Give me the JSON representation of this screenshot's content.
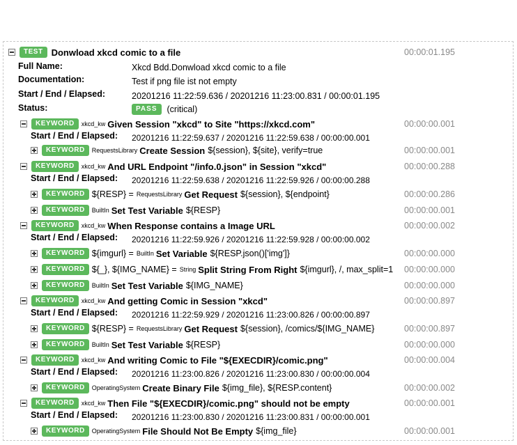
{
  "test": {
    "badge": "TEST",
    "name": "Donwload xkcd comic to a file",
    "elapsed": "00:00:01.195",
    "full_name_label": "Full Name:",
    "full_name": "Xkcd Bdd.Donwload xkcd comic to a file",
    "doc_label": "Documentation:",
    "doc": "Test if png file ist not empty",
    "times_label": "Start / End / Elapsed:",
    "times": "20201216 11:22:59.636 / 20201216 11:23:00.831 / 00:00:01.195",
    "status_label": "Status:",
    "status": "PASS",
    "status_note": "(critical)"
  },
  "keyword_badge": "KEYWORD",
  "times_label": "Start / End / Elapsed:",
  "keywords": [
    {
      "lib": "xkcd_kw",
      "name": "Given Session \"xkcd\" to Site \"https://xkcd.com\"",
      "elapsed": "00:00:00.001",
      "times": "20201216 11:22:59.637 / 20201216 11:22:59.638 / 00:00:00.001",
      "children": [
        {
          "assign": "",
          "lib": "RequestsLibrary",
          "name": "Create Session",
          "args": "${session}, ${site}, verify=true",
          "elapsed": "00:00:00.001"
        }
      ]
    },
    {
      "lib": "xkcd_kw",
      "name": "And URL Endpoint \"/info.0.json\" in Session \"xkcd\"",
      "elapsed": "00:00:00.288",
      "times": "20201216 11:22:59.638 / 20201216 11:22:59.926 / 00:00:00.288",
      "children": [
        {
          "assign": "${RESP} =",
          "lib": "RequestsLibrary",
          "name": "Get Request",
          "args": "${session}, ${endpoint}",
          "elapsed": "00:00:00.286"
        },
        {
          "assign": "",
          "lib": "BuiltIn",
          "name": "Set Test Variable",
          "args": "${RESP}",
          "elapsed": "00:00:00.001"
        }
      ]
    },
    {
      "lib": "xkcd_kw",
      "name": "When Response contains a Image URL",
      "elapsed": "00:00:00.002",
      "times": "20201216 11:22:59.926 / 20201216 11:22:59.928 / 00:00:00.002",
      "children": [
        {
          "assign": "${imgurl} =",
          "lib": "BuiltIn",
          "name": "Set Variable",
          "args": "${RESP.json()['img']}",
          "elapsed": "00:00:00.000"
        },
        {
          "assign": "${_}, ${IMG_NAME} =",
          "lib": "String",
          "name": "Split String From Right",
          "args": "${imgurl}, /, max_split=1",
          "elapsed": "00:00:00.000"
        },
        {
          "assign": "",
          "lib": "BuiltIn",
          "name": "Set Test Variable",
          "args": "${IMG_NAME}",
          "elapsed": "00:00:00.000"
        }
      ]
    },
    {
      "lib": "xkcd_kw",
      "name": "And getting Comic in Session \"xkcd\"",
      "elapsed": "00:00:00.897",
      "times": "20201216 11:22:59.929 / 20201216 11:23:00.826 / 00:00:00.897",
      "children": [
        {
          "assign": "${RESP} =",
          "lib": "RequestsLibrary",
          "name": "Get Request",
          "args": "${session}, /comics/${IMG_NAME}",
          "elapsed": "00:00:00.897"
        },
        {
          "assign": "",
          "lib": "BuiltIn",
          "name": "Set Test Variable",
          "args": "${RESP}",
          "elapsed": "00:00:00.000"
        }
      ]
    },
    {
      "lib": "xkcd_kw",
      "name": "And writing Comic to File \"${EXECDIR}/comic.png\"",
      "elapsed": "00:00:00.004",
      "times": "20201216 11:23:00.826 / 20201216 11:23:00.830 / 00:00:00.004",
      "children": [
        {
          "assign": "",
          "lib": "OperatingSystem",
          "name": "Create Binary File",
          "args": "${img_file}, ${RESP.content}",
          "elapsed": "00:00:00.002"
        }
      ]
    },
    {
      "lib": "xkcd_kw",
      "name": "Then File \"${EXECDIR}/comic.png\" should not be empty",
      "elapsed": "00:00:00.001",
      "times": "20201216 11:23:00.830 / 20201216 11:23:00.831 / 00:00:00.001",
      "children": [
        {
          "assign": "",
          "lib": "OperatingSystem",
          "name": "File Should Not Be Empty",
          "args": "${img_file}",
          "elapsed": "00:00:00.001"
        }
      ]
    }
  ]
}
